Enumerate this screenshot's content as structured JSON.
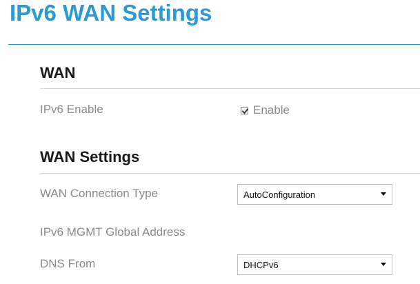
{
  "page": {
    "title": "IPv6 WAN Settings"
  },
  "sections": {
    "wan": {
      "heading": "WAN",
      "ipv6_enable_label": "IPv6 Enable",
      "enable_checkbox_label": "Enable",
      "enable_checked": true
    },
    "wan_settings": {
      "heading": "WAN Settings",
      "connection_type_label": "WAN Connection Type",
      "connection_type_value": "AutoConfiguration",
      "mgmt_address_label": "IPv6 MGMT Global Address",
      "dns_from_label": "DNS From",
      "dns_from_value": "DHCPv6"
    }
  },
  "icons": {
    "checkbox": "checkmark-icon",
    "dropdown": "chevron-down-icon"
  },
  "colors": {
    "title": "#2a9ad6",
    "title_rule": "#2a9ad6",
    "heading": "#1a1a1a",
    "label": "#8a8a8a",
    "section_rule": "#d8d8d8"
  }
}
